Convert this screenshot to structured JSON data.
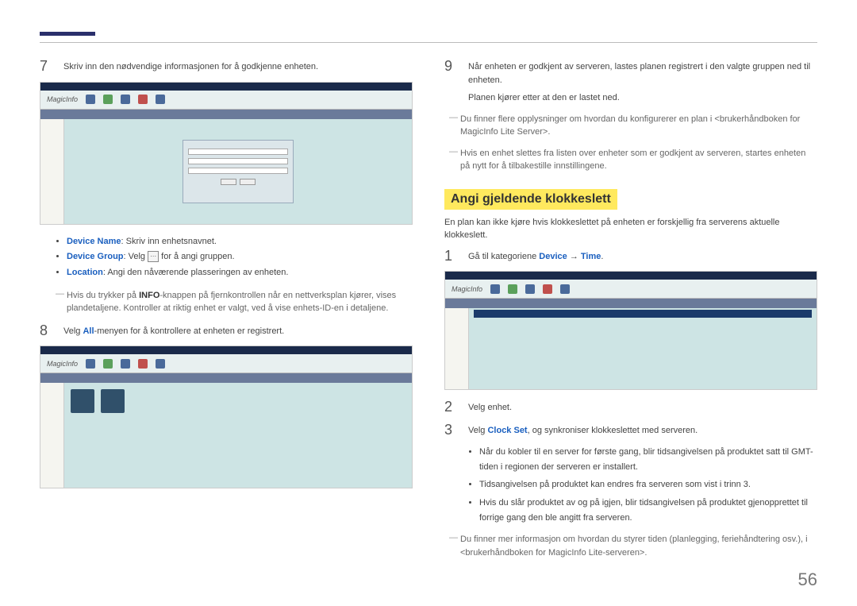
{
  "page_number": "56",
  "left": {
    "step7": {
      "num": "7",
      "text": "Skriv inn den nødvendige informasjonen for å godkjenne enheten."
    },
    "bullets": {
      "device_name_label": "Device Name",
      "device_name_text": ": Skriv inn enhetsnavnet.",
      "device_group_label": "Device Group",
      "device_group_text_before": ": Velg ",
      "device_group_text_after": " for å angi gruppen.",
      "location_label": "Location",
      "location_text": ": Angi den nåværende plasseringen av enheten."
    },
    "note_info": "Hvis du trykker på ",
    "note_info_bold": "INFO",
    "note_info_after": "-knappen på fjernkontrollen når en nettverksplan kjører, vises plandetaljene. Kontroller at riktig enhet er valgt, ved å vise enhets-ID-en i detaljene.",
    "step8": {
      "num": "8",
      "text_before": "Velg ",
      "all": "All",
      "text_after": "-menyen for å kontrollere at enheten er registrert."
    }
  },
  "right": {
    "step9": {
      "num": "9",
      "text1": "Når enheten er godkjent av serveren, lastes planen registrert i den valgte gruppen ned til enheten.",
      "text2": "Planen kjører etter at den er lastet ned."
    },
    "note1": "Du finner flere opplysninger om hvordan du konfigurerer en plan i <brukerhåndboken for MagicInfo Lite Server>.",
    "note2": "Hvis en enhet slettes fra listen over enheter som er godkjent av serveren, startes enheten på nytt for å tilbakestille innstillingene.",
    "heading": "Angi gjeldende klokkeslett",
    "intro": "En plan kan ikke kjøre hvis klokkeslettet på enheten er forskjellig fra serverens aktuelle klokkeslett.",
    "step1": {
      "num": "1",
      "text_before": "Gå til kategoriene ",
      "device": "Device",
      "arrow": " → ",
      "time": "Time",
      "text_after": "."
    },
    "step2": {
      "num": "2",
      "text": "Velg enhet."
    },
    "step3": {
      "num": "3",
      "text_before": "Velg ",
      "clock": "Clock Set",
      "text_after": ", og synkroniser klokkeslettet med serveren."
    },
    "sub1": "Når du kobler til en server for første gang, blir tidsangivelsen på produktet satt til GMT-tiden i regionen der serveren er installert.",
    "sub2": "Tidsangivelsen på produktet kan endres fra serveren som vist i trinn 3.",
    "sub3": "Hvis du slår produktet av og på igjen, blir tidsangivelsen på produktet gjenopprettet til forrige gang den ble angitt fra serveren.",
    "note3": "Du finner mer informasjon om hvordan du styrer tiden (planlegging, feriehåndtering osv.), i <brukerhåndboken for MagicInfo Lite-serveren>."
  },
  "screenshot_brand": "MagicInfo"
}
